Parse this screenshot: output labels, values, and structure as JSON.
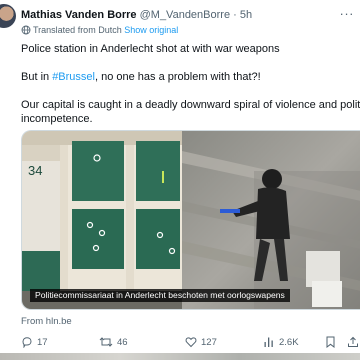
{
  "tweet": {
    "author_name": "Mathias Vanden Borre",
    "handle": "@M_VandenBorre",
    "separator": " · ",
    "time": "5h",
    "translated_label": "Translated from Dutch",
    "show_original": "Show original",
    "line1": "Police station in Anderlecht shot at with war weapons",
    "line2_prefix": "But in ",
    "hashtag": "#Brussel",
    "line2_suffix": ", no one has a problem with that?!",
    "line3a": "Our capital is caught in a deadly downward spiral of violence and political",
    "line3b": "incompetence.",
    "media": {
      "caption": "Politiecommissariaat in Anderlecht beschoten met oorlogswapens",
      "door_number": "34"
    },
    "source": "From hln.be",
    "actions": {
      "replies": "17",
      "reposts": "46",
      "likes": "127",
      "views": "2.6K"
    }
  }
}
